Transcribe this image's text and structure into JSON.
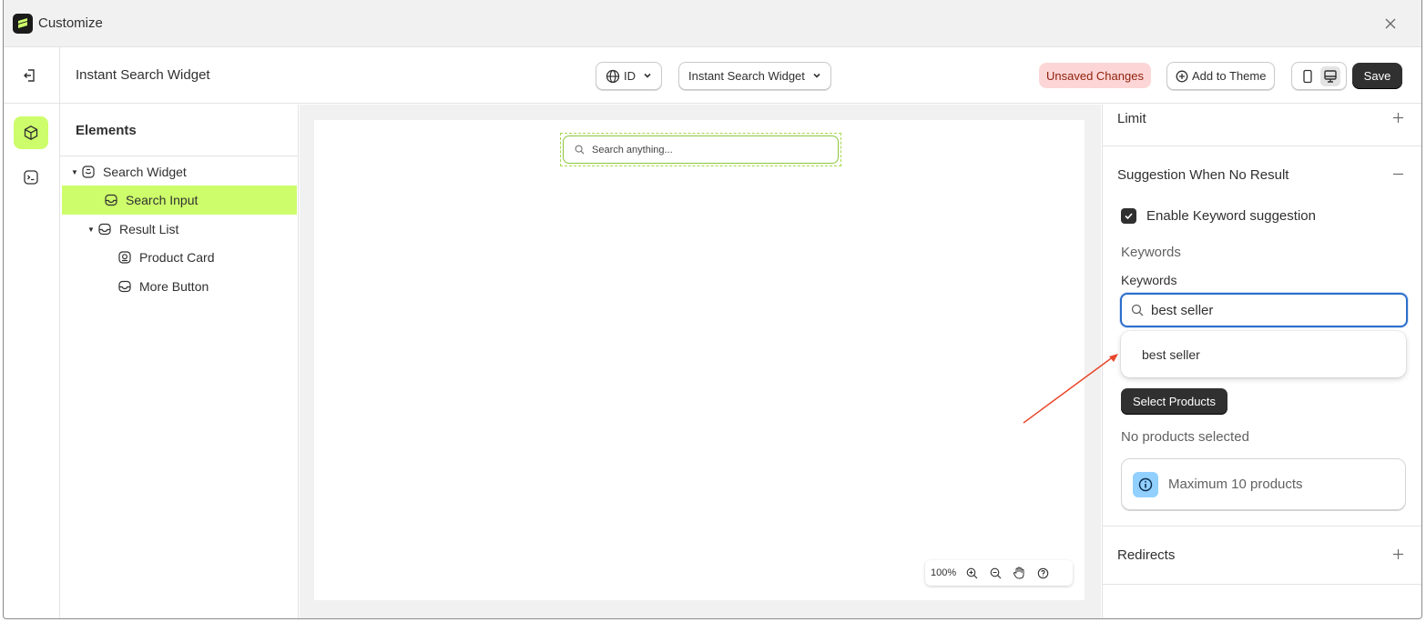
{
  "window": {
    "title": "Customize"
  },
  "toolbar": {
    "page_name": "Instant Search Widget",
    "language": "ID",
    "template": "Instant Search Widget",
    "unsaved": "Unsaved Changes",
    "add_to_theme": "Add to Theme",
    "save": "Save"
  },
  "elements_panel": {
    "title": "Elements",
    "tree": [
      {
        "label": "Search Widget",
        "icon": "search-widget-icon"
      },
      {
        "label": "Search Input",
        "icon": "inbox-icon",
        "selected": true
      },
      {
        "label": "Result List",
        "icon": "inbox-icon"
      },
      {
        "label": "Product Card",
        "icon": "product-card-icon"
      },
      {
        "label": "More Button",
        "icon": "inbox-icon"
      }
    ]
  },
  "canvas": {
    "search_placeholder": "Search anything...",
    "zoom": "100%"
  },
  "settings": {
    "limit": "Limit",
    "suggestion_section": "Suggestion When No Result",
    "enable_keyword": "Enable Keyword suggestion",
    "keywords_heading": "Keywords",
    "keywords_label": "Keywords",
    "keyword_value": "best seller",
    "dropdown_option": "best seller",
    "select_products": "Select Products",
    "no_products": "No products selected",
    "max_products": "Maximum 10 products",
    "redirects": "Redirects"
  },
  "colors": {
    "accent_green": "#cdfd6b",
    "focus_blue": "#2c6ecb",
    "unsaved_bg": "#fcd6d6",
    "annotation_arrow": "#e8472b"
  }
}
